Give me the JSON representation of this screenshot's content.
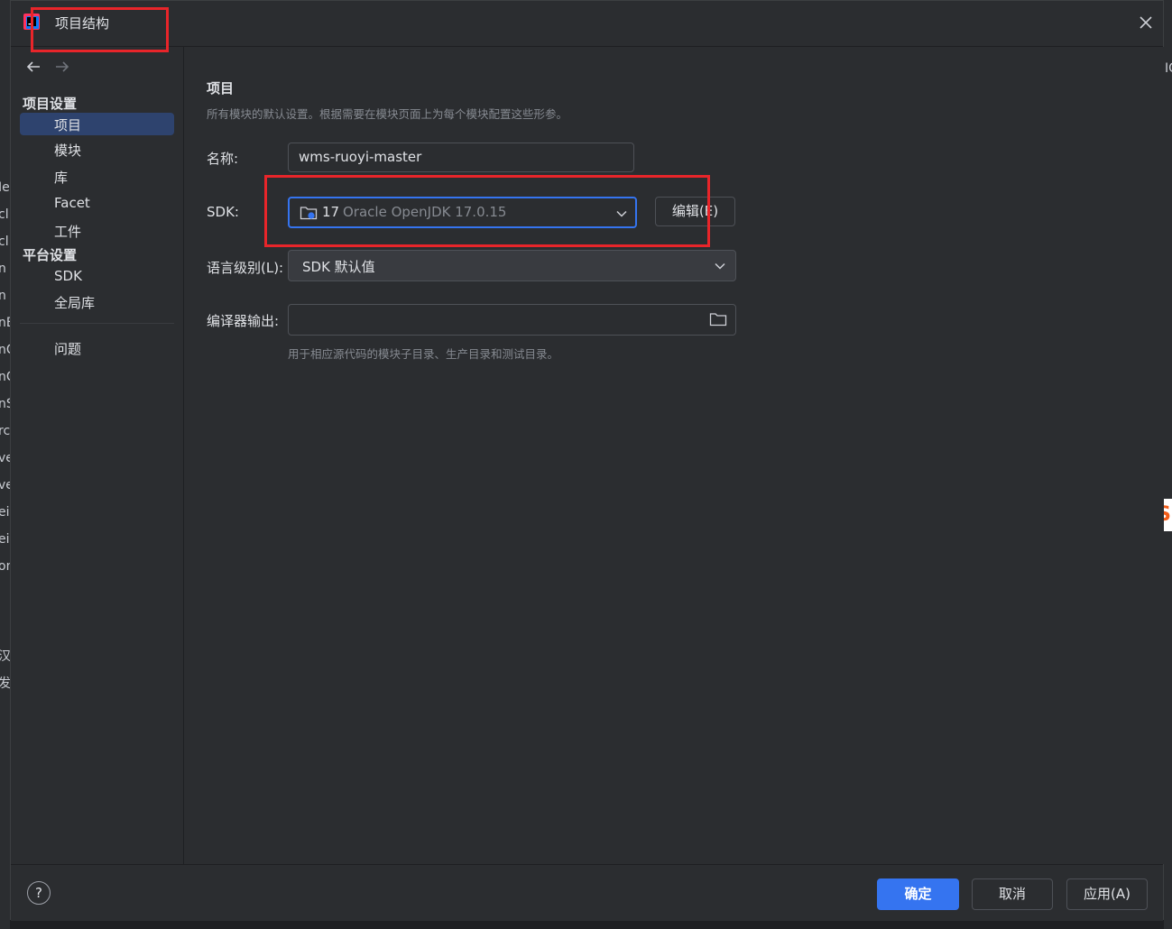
{
  "dialog": {
    "title": "项目结构",
    "close_icon": "close-icon",
    "nav": {
      "back_icon": "arrow-left-icon",
      "forward_icon": "arrow-right-icon"
    }
  },
  "sidebar": {
    "project_settings_header": "项目设置",
    "project_items": [
      "项目",
      "模块",
      "库",
      "Facet",
      "工件"
    ],
    "platform_settings_header": "平台设置",
    "platform_items": [
      "SDK",
      "全局库"
    ],
    "problems": "问题",
    "selected": "项目"
  },
  "main": {
    "section_title": "项目",
    "section_desc": "所有模块的默认设置。根据需要在模块页面上为每个模块配置这些形参。",
    "name_label": "名称:",
    "name_value": "wms-ruoyi-master",
    "sdk_label": "SDK:",
    "sdk_version": "17",
    "sdk_name": "Oracle OpenJDK 17.0.15",
    "edit_button": "编辑(E)",
    "language_label": "语言级别(L):",
    "language_value": "SDK 默认值",
    "compiler_output_label": "编译器输出:",
    "compiler_output_value": "",
    "compiler_output_hint": "用于相应源代码的模块子目录、生产目录和测试目录。"
  },
  "footer": {
    "help": "?",
    "ok": "确定",
    "cancel": "取消",
    "apply": "应用(A)"
  },
  "background_fragments": {
    "left": [
      "Ie",
      "cl",
      "cl",
      "n",
      "n",
      "nE",
      "nC",
      "nC",
      "nS",
      "rc",
      "ve",
      "ve",
      "ei",
      "ei",
      "on",
      "汉",
      "发"
    ],
    "right": [
      "IC"
    ],
    "badge": "S"
  },
  "colors": {
    "accent": "#3574f0",
    "selection": "#2e436e",
    "annotation": "#e8252a",
    "background": "#2b2d30"
  }
}
